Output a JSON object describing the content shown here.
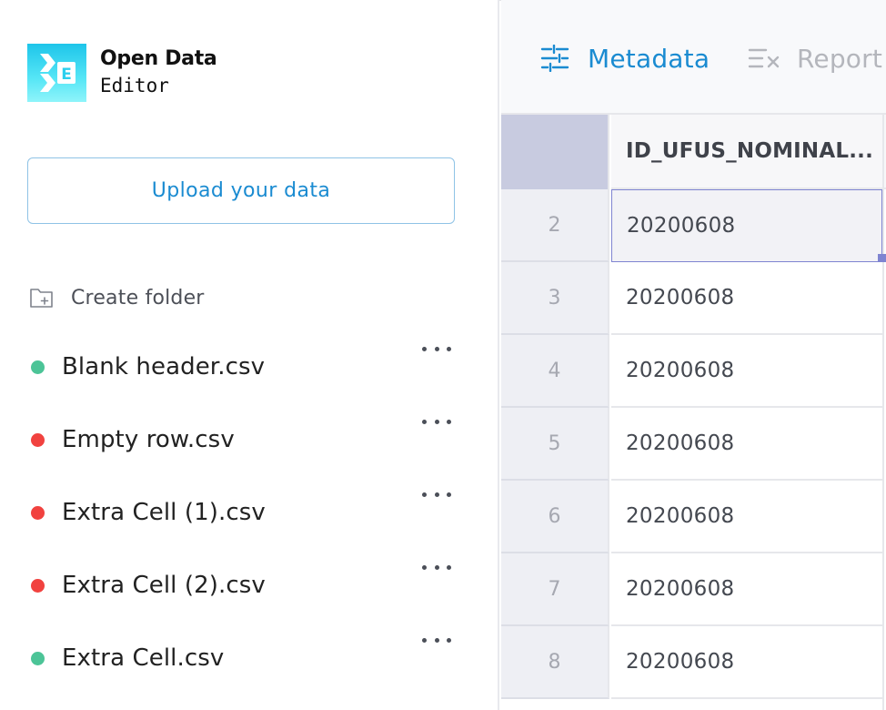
{
  "app": {
    "title_line1": "Open Data",
    "title_line2": "Editor"
  },
  "sidebar": {
    "upload_label": "Upload your data",
    "create_folder_label": "Create folder",
    "files": [
      {
        "name": "Blank header.csv",
        "status": "valid",
        "color": "#4cc497"
      },
      {
        "name": "Empty row.csv",
        "status": "error",
        "color": "#f1423f"
      },
      {
        "name": "Extra Cell (1).csv",
        "status": "error",
        "color": "#f1423f"
      },
      {
        "name": "Extra Cell (2).csv",
        "status": "error",
        "color": "#f1423f"
      },
      {
        "name": "Extra Cell.csv",
        "status": "valid",
        "color": "#4cc497"
      }
    ]
  },
  "tabs": {
    "metadata": "Metadata",
    "report": "Report"
  },
  "table": {
    "column_header": "ID_UFUS_NOMINAL...",
    "rows": [
      {
        "num": "2",
        "value": "20200608"
      },
      {
        "num": "3",
        "value": "20200608"
      },
      {
        "num": "4",
        "value": "20200608"
      },
      {
        "num": "5",
        "value": "20200608"
      },
      {
        "num": "6",
        "value": "20200608"
      },
      {
        "num": "7",
        "value": "20200608"
      },
      {
        "num": "8",
        "value": "20200608"
      }
    ]
  },
  "colors": {
    "accent": "#1a8bd1",
    "valid": "#4cc497",
    "error": "#f1423f",
    "selection": "#7f84d1"
  }
}
